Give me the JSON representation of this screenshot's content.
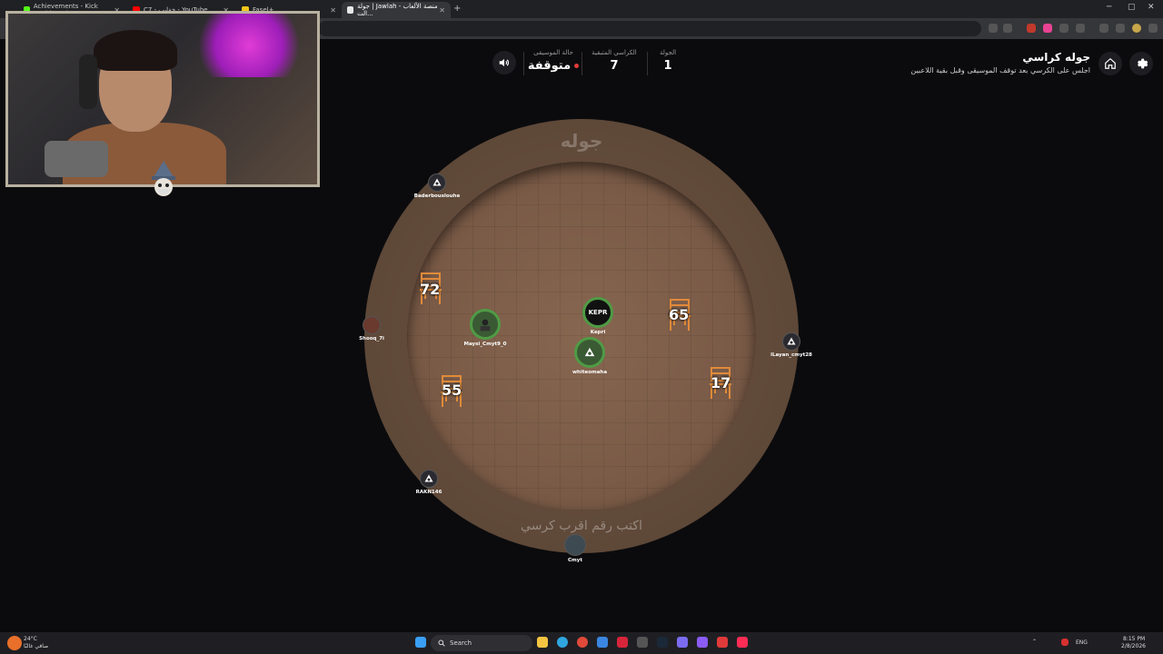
{
  "browser": {
    "tabs": [
      {
        "title": "Achievements - Kick Dashboard",
        "color": "#53fc18"
      },
      {
        "title": "C7 - خفايب - YouTube",
        "color": "#ff0000"
      },
      {
        "title": "Fasel+",
        "color": "#f5c518"
      },
      {
        "title": "جولة | Jawlah - منصة الألعاب الت...",
        "color": "#e8e8e8"
      }
    ],
    "new_tab_label": "+"
  },
  "game": {
    "title": "جوله كراسي",
    "subtitle": "اجلس على الكرسي بعد توقف الموسيقى وقبل بقية اللاعبين",
    "stats": {
      "round_label": "الجولة",
      "round_value": "1",
      "chairs_label": "الكراسي المتبقية",
      "chairs_value": "7",
      "music_label": "حالة الموسيقى",
      "music_value": "متوقفة"
    },
    "board": {
      "title": "جوله",
      "hint": "اكتب رقم اقرب كرسي"
    },
    "chairs": [
      "72",
      "65",
      "55",
      "17"
    ],
    "players": [
      {
        "name": "Baderbouslouhe"
      },
      {
        "name": "Shooq_7i"
      },
      {
        "name": "Maysi_Cmyt9_0"
      },
      {
        "name": "Kepri",
        "badge": "KEPR"
      },
      {
        "name": "whiteomaha"
      },
      {
        "name": "lLayan_cmyt28"
      },
      {
        "name": "RAKN146"
      },
      {
        "name": "Cmyt"
      }
    ]
  },
  "taskbar": {
    "search_label": "Search",
    "weather_temp": "24°C",
    "weather_desc": "صافي غالبًا",
    "lang": "ENG",
    "time": "8:15 PM",
    "date": "2/8/2026"
  },
  "colors": {
    "seated_ring": "#4f9b45",
    "music_stopped": "#e23b3b",
    "board_outer": "#5e4838",
    "board_inner": "#7a5b47"
  }
}
